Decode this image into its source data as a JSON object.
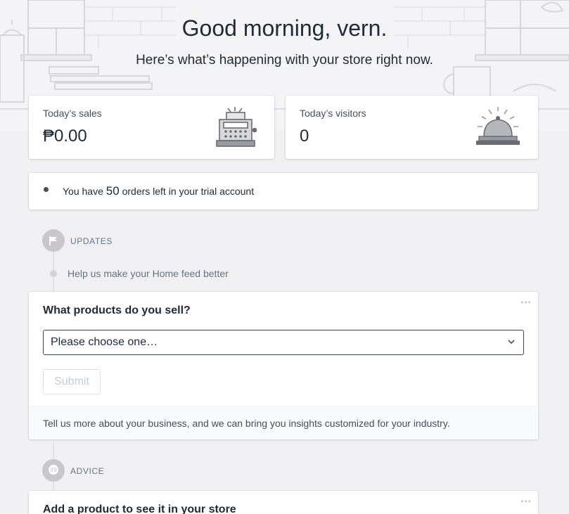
{
  "hero": {
    "greeting": "Good morning, vern.",
    "subtitle": "Here’s what’s happening with your store right now."
  },
  "stats": {
    "sales": {
      "label": "Today’s sales",
      "value": "₱0.00",
      "icon": "cash-register-icon"
    },
    "visitors": {
      "label": "Today’s visitors",
      "value": "0",
      "icon": "service-bell-icon"
    }
  },
  "trial": {
    "prefix": "You have",
    "count": "50",
    "suffix": "orders left in your trial account"
  },
  "updates": {
    "section_title": "Updates",
    "icon": "flag-icon",
    "feed_item": "Help us make your Home feed better",
    "card": {
      "title": "What products do you sell?",
      "select_placeholder": "Please choose one…",
      "submit_label": "Submit",
      "footer_text": "Tell us more about your business, and we can bring you insights customized for your industry."
    }
  },
  "advice": {
    "section_title": "Advice",
    "icon": "quote-bubble-icon",
    "card_title": "Add a product to see it in your store"
  },
  "colors": {
    "background": "#f1f1f4",
    "card": "#ffffff",
    "text": "#212b36",
    "muted": "#637381",
    "badge": "#c9c6cd"
  }
}
